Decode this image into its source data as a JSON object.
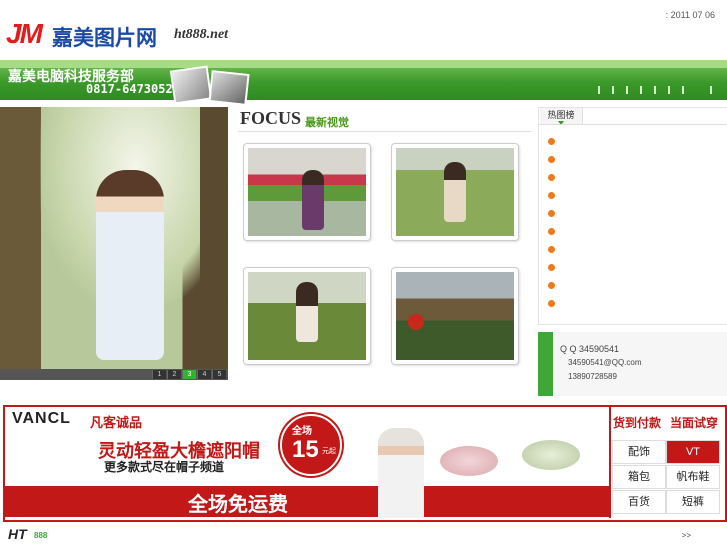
{
  "header": {
    "logo_mark": "JM",
    "logo_name": "嘉美图片网",
    "logo_url": "ht888.net",
    "date": ": 2011 07 06"
  },
  "banner": {
    "company": "嘉美电脑科技服务部",
    "phone": "0817-6473052"
  },
  "slideshow": {
    "pages": [
      "1",
      "2",
      "3",
      "4",
      "5"
    ],
    "active_page": "3"
  },
  "focus": {
    "title_en": "FOCUS",
    "title_cn": "最新视觉"
  },
  "hot": {
    "tab_label": "热图榜",
    "items": [
      "",
      "",
      "",
      "",
      "",
      "",
      "",
      "",
      "",
      ""
    ]
  },
  "contact": {
    "qq": "Q Q 34590541",
    "email": "34590541@QQ.com",
    "phone": "13890728589"
  },
  "ad": {
    "brand": "VANCL",
    "brand_cn": "凡客诚品",
    "headline": "灵动轻盈大檐遮阳帽",
    "subline": "更多款式尽在帽子频道",
    "badge_top": "全场",
    "badge_price": "15",
    "badge_unit": "元起",
    "free_shipping": "全场免运费",
    "right_1": "货到付款",
    "right_2": "当面试穿",
    "categories": [
      "配饰",
      "VT",
      "箱包",
      "帆布鞋",
      "百货",
      "短裤"
    ]
  },
  "footer": {
    "logo": "HT",
    "logo_sub": "888",
    "more": ">>"
  }
}
